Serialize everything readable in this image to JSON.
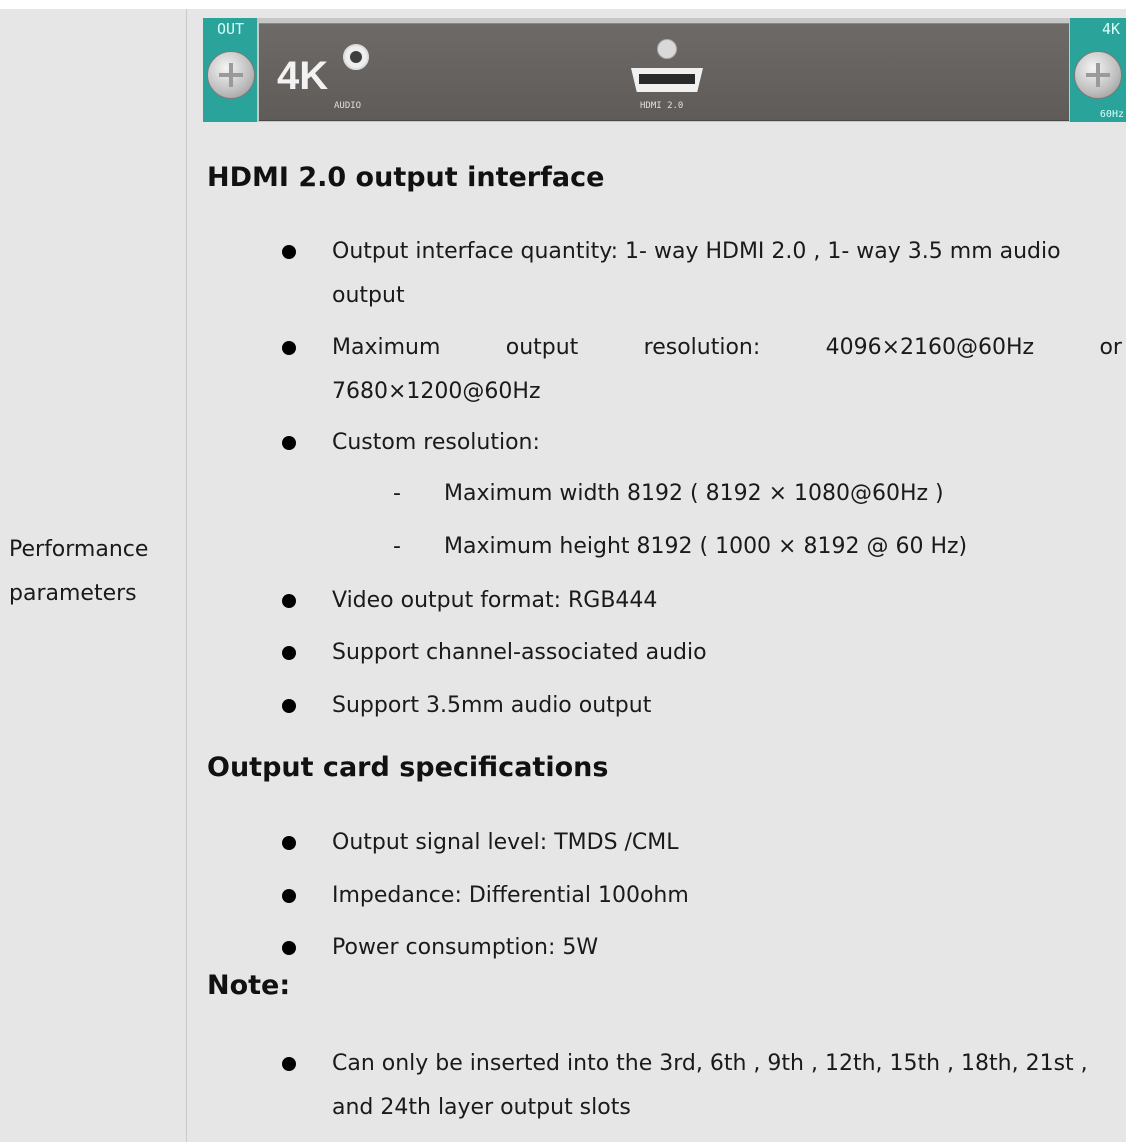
{
  "table": {
    "left_label_line1": "Performance",
    "left_label_line2": "parameters"
  },
  "panel": {
    "tab_left": "OUT",
    "tab_right_top": "4K",
    "tab_right_bottom": "60Hz",
    "plate_label": "4K",
    "audio_label": "AUDIO",
    "hdmi_label": "HDMI 2.0"
  },
  "sections": {
    "hdmi": {
      "heading": "HDMI 2.0 output interface",
      "item1_line1": "Output interface quantity: 1- way HDMI 2.0 , 1- way 3.5 mm audio",
      "item1_line2": "output",
      "item2_words": [
        "Maximum",
        "output",
        "resolution:",
        "4096×2160@60Hz",
        "or"
      ],
      "item2_line2": "7680×1200@60Hz",
      "item3": "Custom resolution:",
      "sub_dash": "-",
      "sub1": "Maximum width 8192 ( 8192  ×  1080@60Hz )",
      "sub2": "Maximum height 8192 ( 1000  ×  8192 @ 60 Hz)",
      "item4": "Video output format: RGB444",
      "item5": "Support channel-associated audio",
      "item6": "Support 3.5mm audio output"
    },
    "card": {
      "heading": "Output card specifications",
      "item1": "Output signal level: TMDS /CML",
      "item2": "Impedance: Differential 100ohm",
      "item3": "Power consumption: 5W"
    },
    "note": {
      "heading": "Note:",
      "item1_line1": "Can only be inserted into the 3rd, 6th , 9th , 12th, 15th , 18th, 21st ,",
      "item1_line2": "and 24th layer output slots"
    }
  }
}
